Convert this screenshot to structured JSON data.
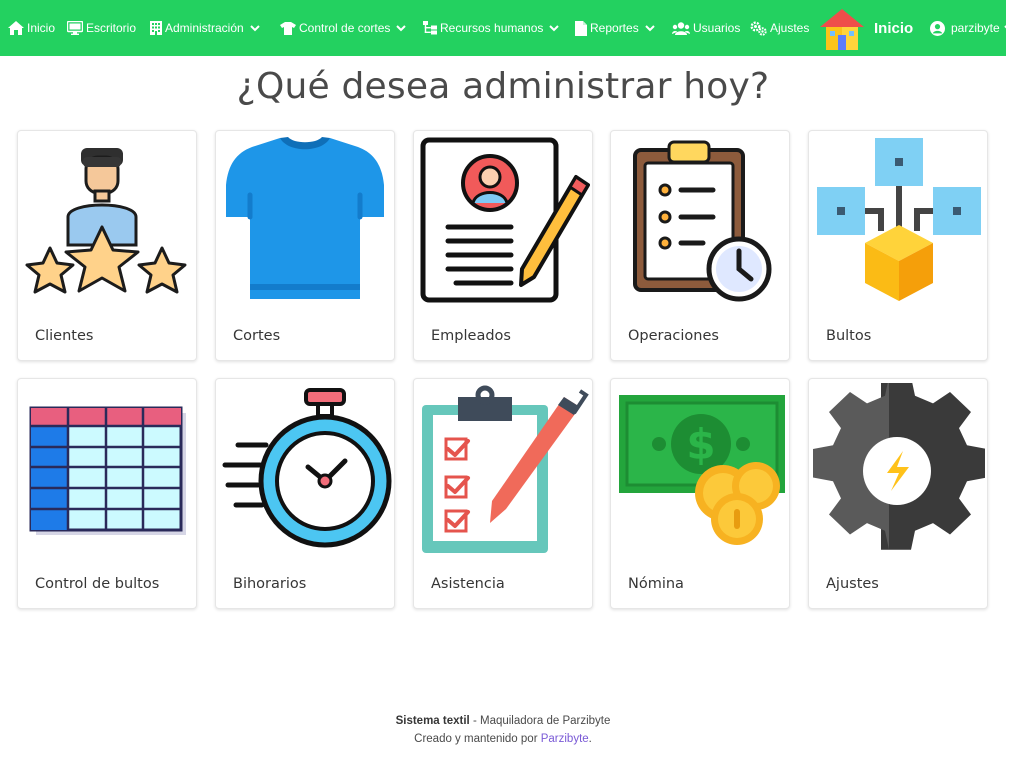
{
  "navbar": {
    "items": [
      {
        "label": "Inicio",
        "icon": "home-icon",
        "dropdown": false
      },
      {
        "label": "Escritorio",
        "icon": "desktop-icon",
        "dropdown": false
      },
      {
        "label": "Administración",
        "icon": "building-icon",
        "dropdown": true
      },
      {
        "label": "Control de cortes",
        "icon": "tshirt-icon",
        "dropdown": true
      },
      {
        "label": "Recursos humanos",
        "icon": "sitemap-icon",
        "dropdown": true
      },
      {
        "label": "Reportes",
        "icon": "file-icon",
        "dropdown": true
      },
      {
        "label": "Usuarios",
        "icon": "users-icon",
        "dropdown": false
      },
      {
        "label": "Ajustes",
        "icon": "gears-icon",
        "dropdown": false
      }
    ],
    "brand_label": "Inicio",
    "user_label": "parzibyte",
    "accent_color": "#23d160"
  },
  "main": {
    "title": "¿Qué desea administrar hoy?",
    "cards": [
      {
        "label": "Clientes",
        "icon": "client-rating-icon"
      },
      {
        "label": "Cortes",
        "icon": "tshirt-icon"
      },
      {
        "label": "Empleados",
        "icon": "resume-icon"
      },
      {
        "label": "Operaciones",
        "icon": "clipboard-clock-icon"
      },
      {
        "label": "Bultos",
        "icon": "cube-network-icon"
      },
      {
        "label": "Control de bultos",
        "icon": "spreadsheet-icon"
      },
      {
        "label": "Bihorarios",
        "icon": "stopwatch-icon"
      },
      {
        "label": "Asistencia",
        "icon": "checklist-pen-icon"
      },
      {
        "label": "Nómina",
        "icon": "money-coins-icon"
      },
      {
        "label": "Ajustes",
        "icon": "settings-gear-icon"
      }
    ]
  },
  "footer": {
    "app_name": "Sistema textil",
    "separator": " - ",
    "tagline": "Maquiladora de Parzibyte",
    "credit_prefix": "Creado y mantenido por ",
    "credit_link": "Parzibyte",
    "credit_suffix": "."
  }
}
